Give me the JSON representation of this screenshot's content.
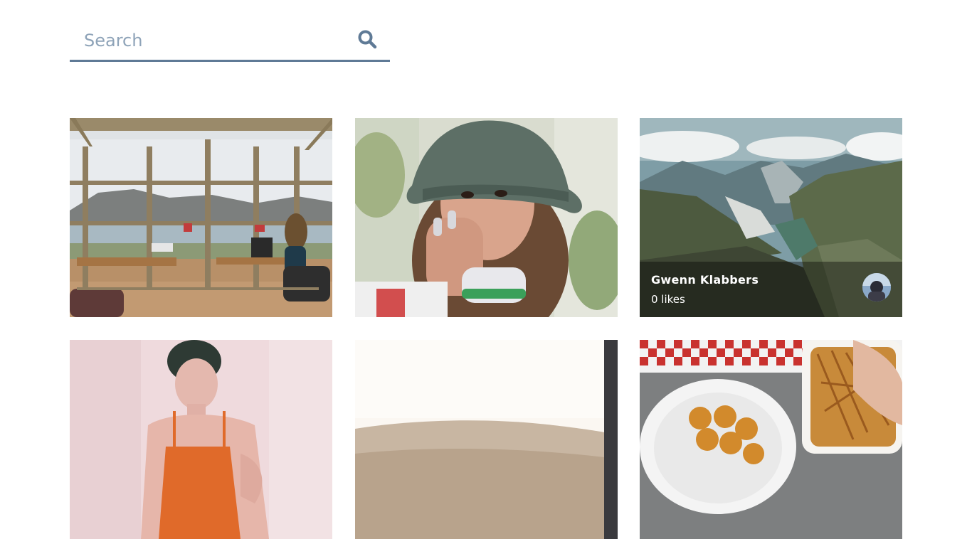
{
  "search": {
    "placeholder": "Search",
    "value": "",
    "icon": "search-icon"
  },
  "colors": {
    "accent": "#5f7a96",
    "placeholder": "#8ea3b8"
  },
  "photos": [
    {
      "subject": "sunroom workspace with lake view",
      "author": "",
      "likes": ""
    },
    {
      "subject": "woman in bucket hat",
      "author": "",
      "likes": ""
    },
    {
      "subject": "mountain fjord valley",
      "author": "Gwenn Klabbers",
      "likes": "0 likes",
      "hovered": true
    },
    {
      "subject": "woman in orange top",
      "author": "",
      "likes": ""
    },
    {
      "subject": "desert dunes",
      "author": "",
      "likes": ""
    },
    {
      "subject": "chicken nuggets and fries",
      "author": "",
      "likes": ""
    }
  ]
}
